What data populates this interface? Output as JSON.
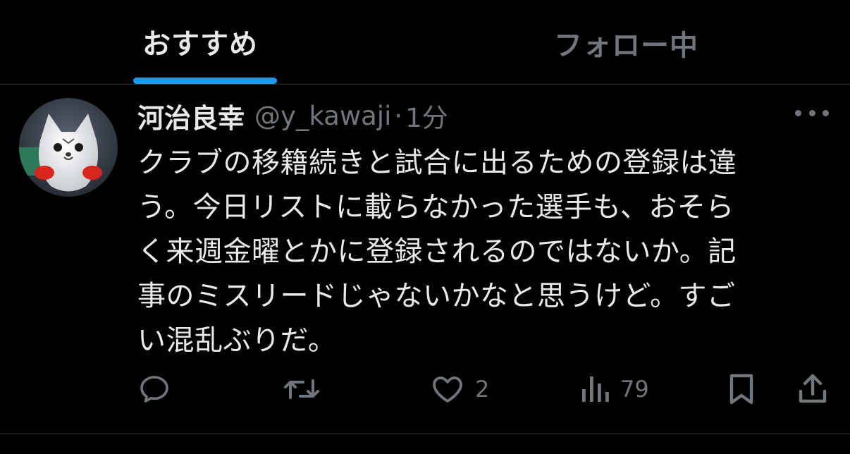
{
  "tabs": {
    "recommended": "おすすめ",
    "following": "フォロー中"
  },
  "post": {
    "display_name": "河治良幸",
    "handle": "@y_kawaji",
    "separator": "·",
    "time": "1分",
    "text_lines": [
      "クラブの移籍続きと試合に出るための登録は違",
      "う。今日リストに載らなかった選手も、おそら",
      "く来週金曜とかに登録されるのではないか。記",
      "事のミスリードじゃないかなと思うけど。すご",
      "い混乱ぶりだ。"
    ],
    "likes": "2",
    "views": "79"
  },
  "icons": {
    "more": "more-icon",
    "reply": "reply-icon",
    "repost": "repost-icon",
    "like": "heart-icon",
    "views": "views-icon",
    "bookmark": "bookmark-icon",
    "share": "share-icon"
  },
  "colors": {
    "background": "#000000",
    "text": "#e7e9ea",
    "muted": "#71767b",
    "accent": "#1d9bf0",
    "divider": "#2f3336"
  }
}
